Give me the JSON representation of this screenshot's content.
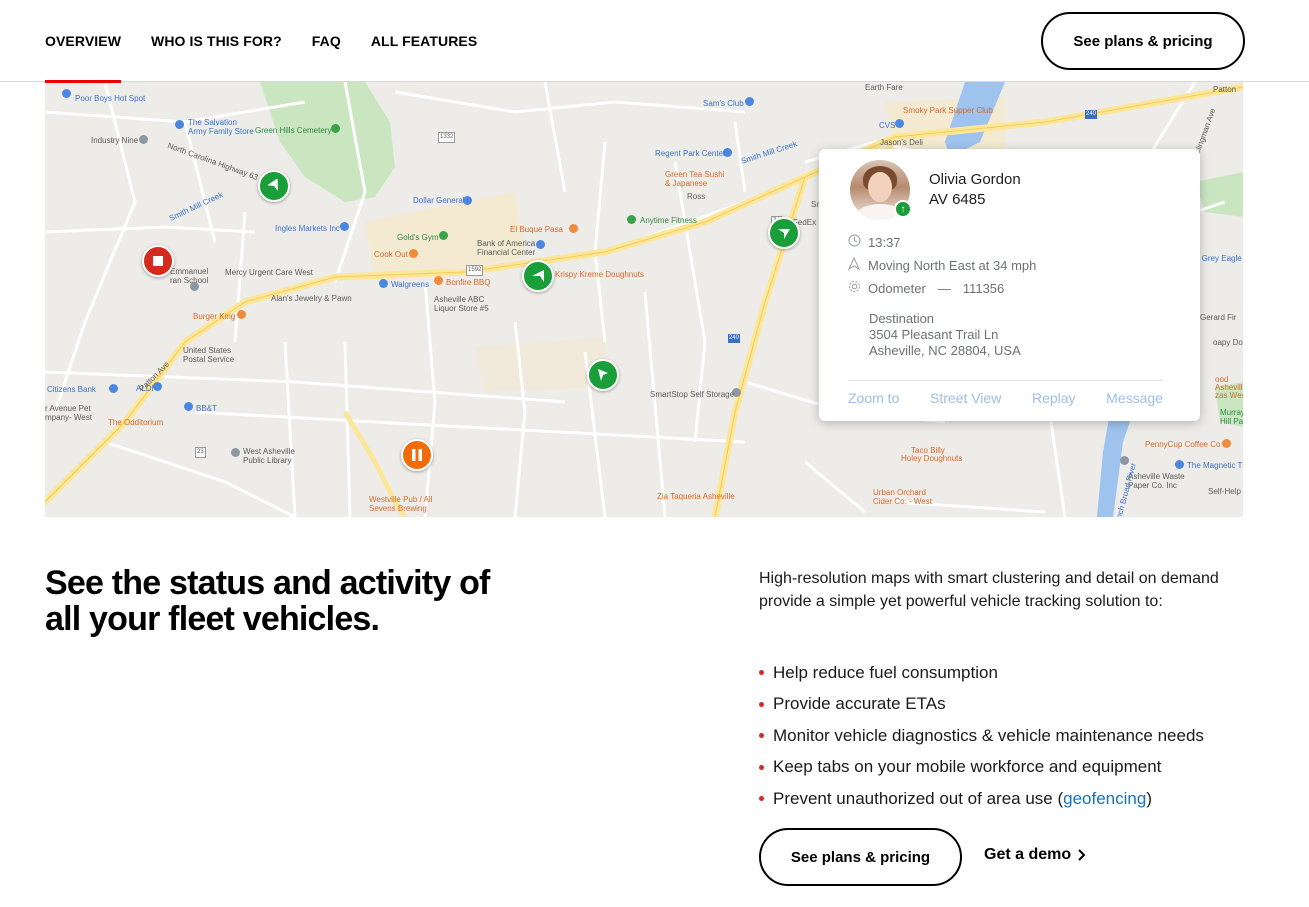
{
  "nav": {
    "links": [
      "OVERVIEW",
      "WHO IS THIS FOR?",
      "FAQ",
      "ALL FEATURES"
    ],
    "cta": "See plans & pricing"
  },
  "map": {
    "labels": {
      "poor_boys": "Poor Boys Hot Spot",
      "salvation": "The Salvation\nArmy Family Store",
      "green_hills": "Green Hills Cemetery",
      "industry_nine": "Industry Nine",
      "nc63": "North Carolina Highway 63",
      "smith_mill": "Smith Mill Creek",
      "smith_mill2": "Smith Mill Creek",
      "dollar_general": "Dollar General",
      "ingles": "Ingles Markets Inc",
      "golds": "Gold's Gym",
      "cookout": "Cook Out",
      "boa": "Bank of America\nFinancial Center",
      "el_buque": "El Buque Pasa",
      "anytime": "Anytime Fitness",
      "emmanuel": "Emmanuel\nran School",
      "mercy": "Mercy Urgent Care West",
      "walgreens": "Walgreens",
      "bonfire": "Bonfire BBQ",
      "krispy": "Krispy Kreme Doughnuts",
      "alans": "Alan's Jewelry & Pawn",
      "abc": "Asheville ABC\nLiquor Store #5",
      "burger_king": "Burger King",
      "usps": "United States\nPostal Service",
      "citizens": "Citizens Bank",
      "aldi": "ALDI",
      "avenue_pet": "r Avenue Pet\nmpany- West",
      "bbt": "BB&T",
      "odditorium": "The Odditorium",
      "library": "West Asheville\nPublic Library",
      "westville": "Westville Pub / All\nSevens Brewing",
      "smartstop": "SmartStop Self Storage",
      "zia": "Zia Taqueria Asheville",
      "sams": "Sam's Club",
      "regent": "Regent Park Center",
      "green_tea": "Green Tea Sushi\n& Japanese",
      "ross": "Ross",
      "earth_fare": "Earth Fare",
      "smoky": "Smoky Park Supper Club",
      "cvs": "CVS",
      "jasons": "Jason's Deli",
      "smartstop2": "SmartStop",
      "fedex": "FedEx",
      "patton_ave": "Patton Ave",
      "patton_ave2": "Patton",
      "grey_eagle": "e Grey Eagle",
      "sugar": "ugar Ave  Clingman Ave",
      "gerard": "Gerard Fir",
      "soapy": "oapy Dog",
      "ood": "ood\nAsheville\nzas West",
      "murray": "Murray\nHill Park",
      "pennycup": "PennyCup Coffee Co",
      "taco_billy": "Taco Billy",
      "holey": "Holey Doughnuts",
      "magnetic": "The Magnetic Th",
      "waste_paper": "Asheville Waste\nPaper Co. Inc",
      "urban_orchard": "Urban Orchard\nCider Co. - West",
      "self_help": "Self-Help",
      "broad_river": "French Broad River",
      "hwy_1332": "1332",
      "hwy_1592": "1592",
      "hwy_74": "74",
      "hwy_23": "23",
      "hwy_240": "240",
      "hwy_240b": "240"
    },
    "popup": {
      "name": "Olivia Gordon",
      "vehicle": "AV 6485",
      "time": "13:37",
      "motion": "Moving North East at 34 mph",
      "odometer_label": "Odometer",
      "odometer_sep": "—",
      "odometer_value": "111356",
      "dest_label": "Destination",
      "dest_line1": "3504 Pleasant Trail Ln",
      "dest_line2": "Asheville, NC 28804, USA",
      "actions": [
        "Zoom to",
        "Street View",
        "Replay",
        "Message"
      ]
    }
  },
  "content": {
    "headline": "See the status and activity of all your fleet vehicles.",
    "intro": "High-resolution maps with smart clustering and detail on demand provide a simple yet powerful vehicle tracking solution to:",
    "bullets": [
      "Help reduce fuel consumption",
      "Provide accurate ETAs",
      "Monitor vehicle diagnostics & vehicle maintenance needs",
      "Keep tabs on your mobile workforce and equipment"
    ],
    "last_bullet_prefix": "Prevent unauthorized out of area use (",
    "last_bullet_link": "geofencing",
    "last_bullet_suffix": ")",
    "cta": "See plans & pricing",
    "demo": "Get a demo"
  },
  "colors": {
    "accent_red": "#ee0000",
    "vehicle_green": "#1a9e3a",
    "link_blue": "#1774b8"
  }
}
